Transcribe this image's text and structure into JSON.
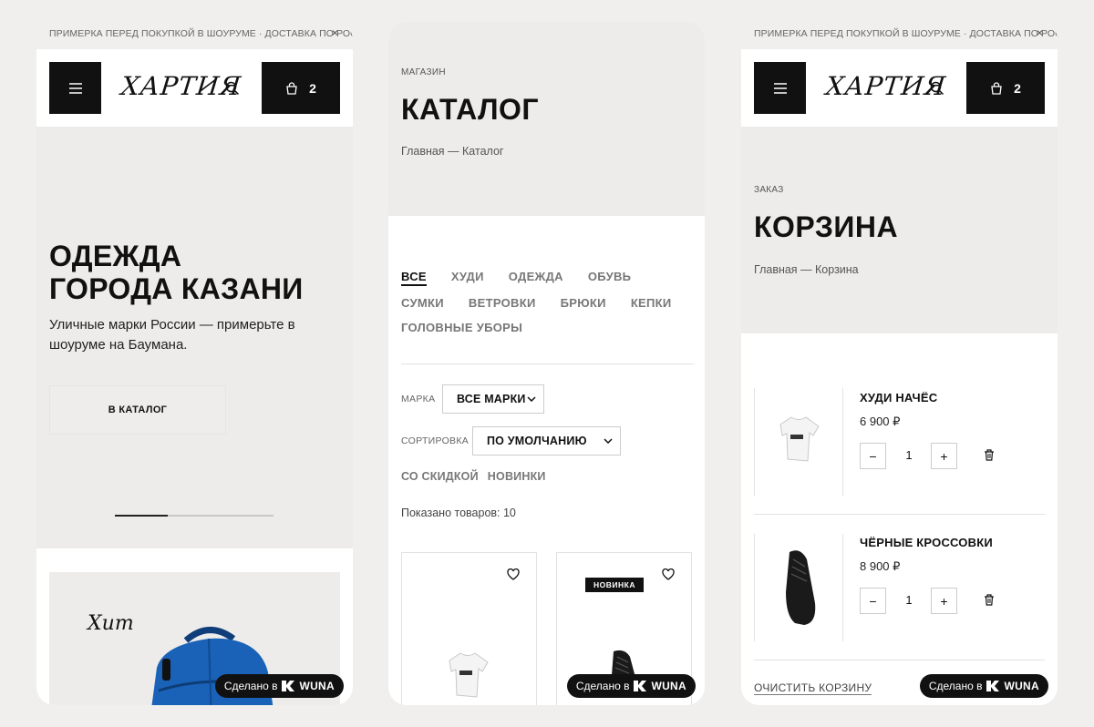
{
  "announcement": "ПРИМЕРКА ПЕРЕД ПОКУПКОЙ В ШОУРУМЕ · ДОСТАВКА ПО РОССИ",
  "announcement_close": "×",
  "header": {
    "logo": "ХАРТИЯ",
    "cart_count": "2"
  },
  "home": {
    "hero_title": "ОДЕЖДА\nГОРОДА КАЗАНИ",
    "hero_subtitle": "Уличные марки России — примерьте в шоуруме на Баумана.",
    "cta_label": "В КАТАЛОГ",
    "slider": {
      "active": 1,
      "total": 3
    },
    "promo_text": "Хит"
  },
  "catalog": {
    "eyebrow": "МАГАЗИН",
    "title": "КАТАЛОГ",
    "breadcrumb": "Главная — Каталог",
    "categories": [
      "ВСЕ",
      "ХУДИ",
      "ОДЕЖДА",
      "ОБУВЬ",
      "СУМКИ",
      "ВЕТРОВКИ",
      "БРЮКИ",
      "КЕПКИ",
      "ГОЛОВНЫЕ УБОРЫ"
    ],
    "brand_label": "МАРКА",
    "brand_value": "ВСЕ МАРКИ",
    "sort_label": "СОРТИРОВКА",
    "sort_value": "ПО УМОЛЧАНИЮ",
    "quick_filters": [
      "СО СКИДКОЙ",
      "НОВИНКИ"
    ],
    "count_text": "Показано товаров: 10",
    "new_badge": "НОВИНКА"
  },
  "cart": {
    "eyebrow": "ЗАКАЗ",
    "title": "КОРЗИНА",
    "breadcrumb": "Главная — Корзина",
    "items": [
      {
        "name": "ХУДИ НАЧЁС",
        "price": "6 900 ₽",
        "qty": "1"
      },
      {
        "name": "ЧЁРНЫЕ КРОССОВКИ",
        "price": "8 900 ₽",
        "qty": "1"
      }
    ],
    "minus": "−",
    "plus": "+",
    "clear_label": "ОЧИСТИТЬ КОРЗИНУ"
  },
  "made_by": {
    "text": "Сделано в",
    "brand": "WUNA"
  },
  "colors": {
    "background": "#f0efed",
    "panel": "#edecea",
    "accent": "#111111",
    "blue_bag": "#1a62b8"
  }
}
